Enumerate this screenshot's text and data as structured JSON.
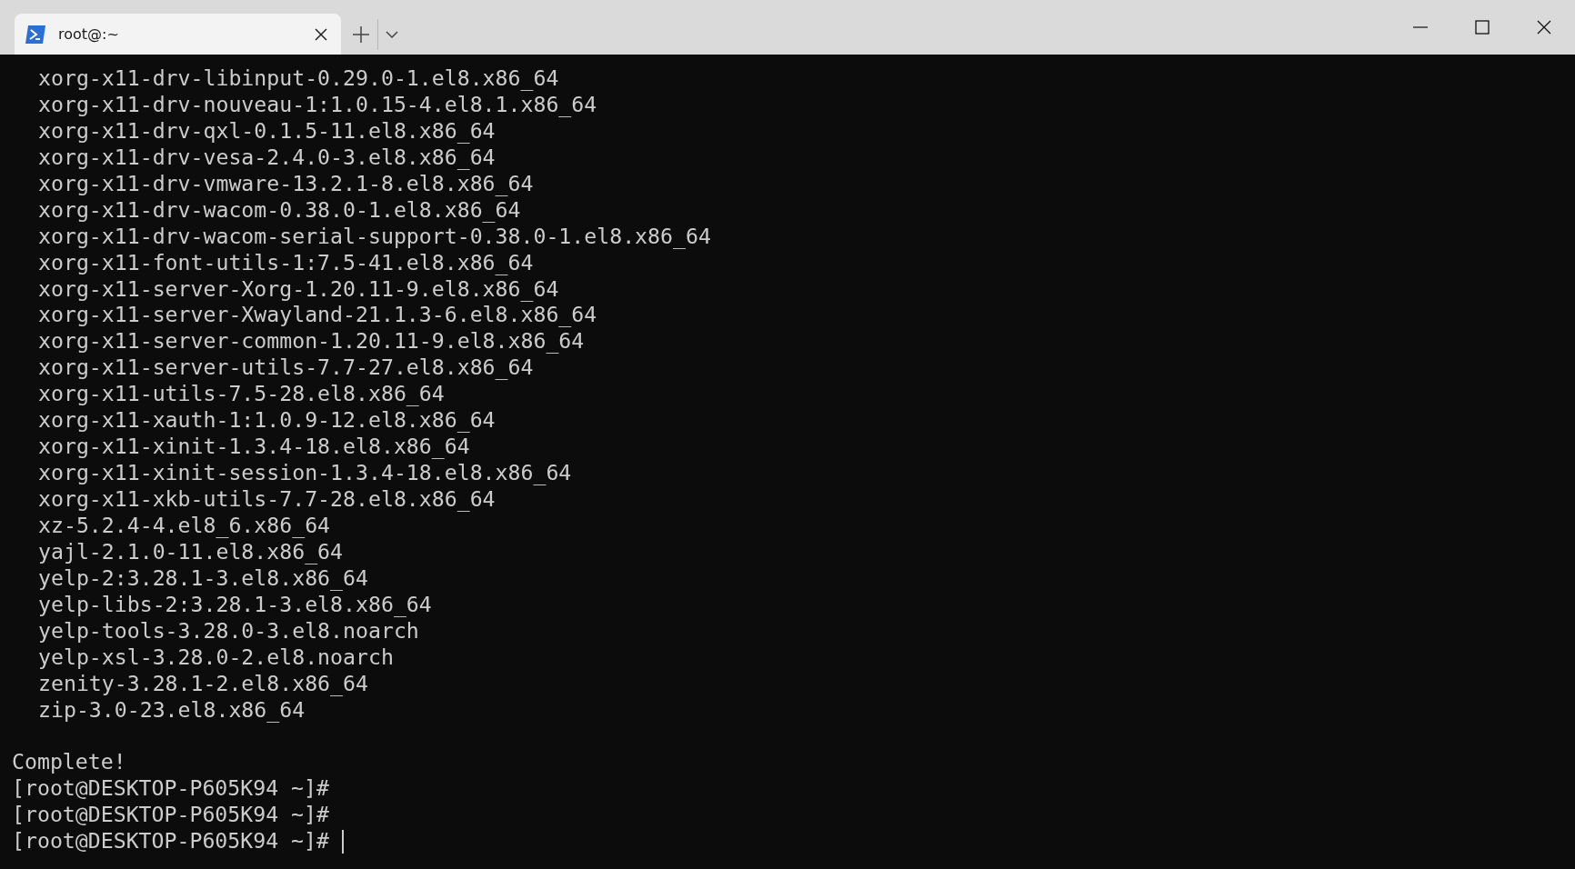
{
  "tab": {
    "title": "root@:~",
    "selected": true
  },
  "output_lines": [
    "xorg-x11-drv-libinput-0.29.0-1.el8.x86_64",
    "xorg-x11-drv-nouveau-1:1.0.15-4.el8.1.x86_64",
    "xorg-x11-drv-qxl-0.1.5-11.el8.x86_64",
    "xorg-x11-drv-vesa-2.4.0-3.el8.x86_64",
    "xorg-x11-drv-vmware-13.2.1-8.el8.x86_64",
    "xorg-x11-drv-wacom-0.38.0-1.el8.x86_64",
    "xorg-x11-drv-wacom-serial-support-0.38.0-1.el8.x86_64",
    "xorg-x11-font-utils-1:7.5-41.el8.x86_64",
    "xorg-x11-server-Xorg-1.20.11-9.el8.x86_64",
    "xorg-x11-server-Xwayland-21.1.3-6.el8.x86_64",
    "xorg-x11-server-common-1.20.11-9.el8.x86_64",
    "xorg-x11-server-utils-7.7-27.el8.x86_64",
    "xorg-x11-utils-7.5-28.el8.x86_64",
    "xorg-x11-xauth-1:1.0.9-12.el8.x86_64",
    "xorg-x11-xinit-1.3.4-18.el8.x86_64",
    "xorg-x11-xinit-session-1.3.4-18.el8.x86_64",
    "xorg-x11-xkb-utils-7.7-28.el8.x86_64",
    "xz-5.2.4-4.el8_6.x86_64",
    "yajl-2.1.0-11.el8.x86_64",
    "yelp-2:3.28.1-3.el8.x86_64",
    "yelp-libs-2:3.28.1-3.el8.x86_64",
    "yelp-tools-3.28.0-3.el8.noarch",
    "yelp-xsl-3.28.0-2.el8.noarch",
    "zenity-3.28.1-2.el8.x86_64",
    "zip-3.0-23.el8.x86_64"
  ],
  "status": "Complete!",
  "prompts": [
    {
      "text": "[root@DESKTOP-P605K94 ~]#",
      "cursor": false
    },
    {
      "text": "[root@DESKTOP-P605K94 ~]#",
      "cursor": false
    },
    {
      "text": "[root@DESKTOP-P605K94 ~]#",
      "cursor": true
    }
  ]
}
